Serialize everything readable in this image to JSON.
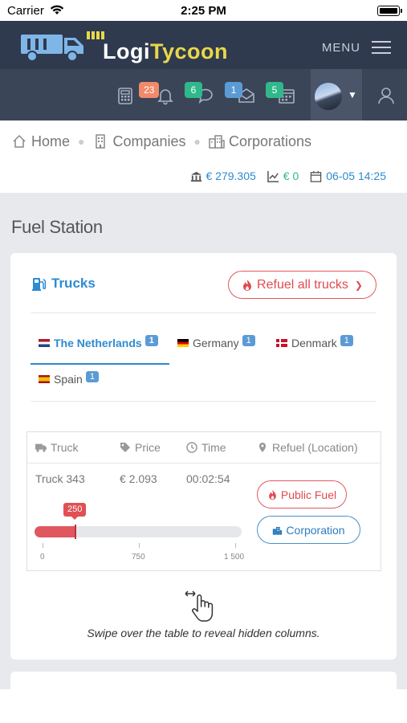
{
  "status_bar": {
    "carrier": "Carrier",
    "time": "2:25 PM"
  },
  "topnav": {
    "app_name": "LogiTycoon",
    "app_name_part1": "Logi",
    "app_name_part2": "Tycoon",
    "menu_label": "MENU"
  },
  "subnav": {
    "badges": {
      "notifications": "23",
      "messages": "6",
      "mail": "1",
      "calendar": "5"
    },
    "colors": {
      "notifications": "#f08a6b",
      "messages": "#2fb98a",
      "mail": "#5b9bd5",
      "calendar": "#2fb98a"
    }
  },
  "breadcrumb": {
    "home": "Home",
    "companies": "Companies",
    "corporations": "Corporations"
  },
  "stats": {
    "money": "€ 279.305",
    "income": "€ 0",
    "datetime": "06-05 14:25"
  },
  "page_title": "Fuel Station",
  "trucks_section": {
    "title": "Trucks",
    "refuel_all_label": "Refuel all trucks",
    "tabs": [
      {
        "label": "The Netherlands",
        "count": "1"
      },
      {
        "label": "Germany",
        "count": "1"
      },
      {
        "label": "Denmark",
        "count": "1"
      },
      {
        "label": "Spain",
        "count": "1"
      }
    ],
    "table": {
      "headers": {
        "truck": "Truck",
        "price": "Price",
        "time": "Time",
        "refuel": "Refuel (Location)"
      },
      "row": {
        "truck": "Truck 343",
        "price": "€ 2.093",
        "time": "00:02:54",
        "slider_value": "250",
        "slider_value_num": 250,
        "slider_min": 0,
        "slider_max": 1500,
        "ticks": [
          "0",
          "750",
          "1 500"
        ],
        "public_fuel_label": "Public Fuel",
        "corporation_label": "Corporation"
      }
    },
    "swipe_hint": "Swipe over the table to reveal hidden columns."
  },
  "colors": {
    "accent_blue": "#2d8bd0",
    "accent_red": "#e04b50",
    "navbar": "#2f3a4f",
    "logo_yellow": "#e8d84a"
  }
}
